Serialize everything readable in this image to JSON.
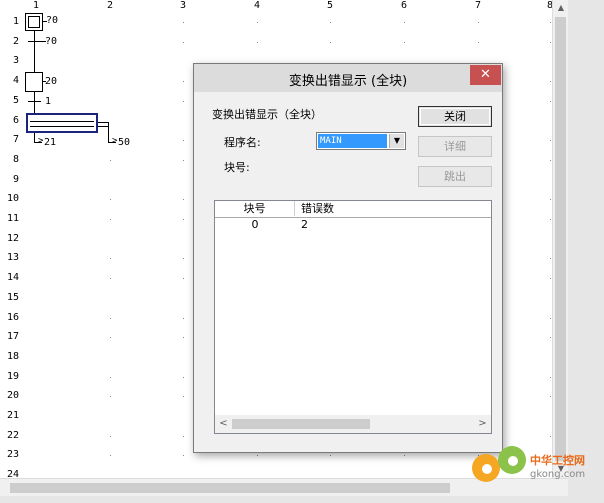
{
  "canvas": {
    "column_numbers": [
      "1",
      "2",
      "3",
      "4",
      "5",
      "6",
      "7",
      "8"
    ],
    "row_numbers": [
      "1",
      "2",
      "3",
      "4",
      "5",
      "6",
      "7",
      "8",
      "9",
      "10",
      "11",
      "12",
      "13",
      "14",
      "15",
      "16",
      "17",
      "18",
      "19",
      "20",
      "21",
      "22",
      "23",
      "24"
    ],
    "sfc_labels": {
      "step1": "?0",
      "trans2": "?0",
      "step4": "20",
      "trans5": "1",
      "branch7_left": "21",
      "branch7_right": "50"
    }
  },
  "dialog": {
    "title": "变换出错显示 (全块)",
    "close_glyph": "✕",
    "heading": "变换出错显示（全块）",
    "program_label": "程序名:",
    "program_value": "MAIN",
    "block_label": "块号:",
    "buttons": {
      "close": "关闭",
      "detail": "详细",
      "jump": "跳出"
    },
    "list": {
      "columns": [
        "块号",
        "错误数"
      ],
      "rows": [
        {
          "block": "0",
          "errors": "2"
        }
      ]
    }
  },
  "watermark": {
    "text": "中华工控网",
    "sub": "gkong.com"
  }
}
